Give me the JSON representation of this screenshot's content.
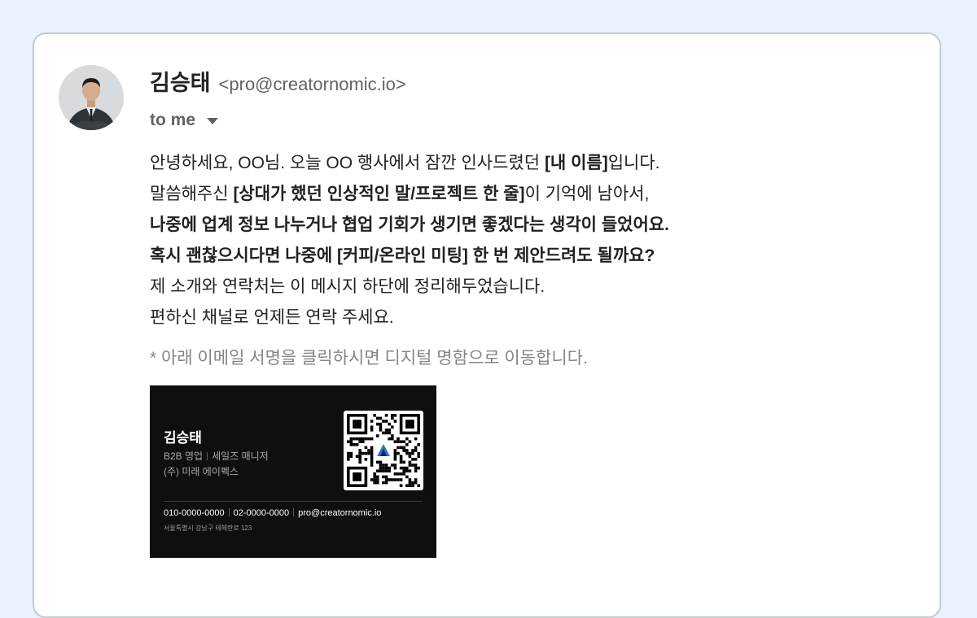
{
  "email": {
    "sender": {
      "name": "김승태",
      "email": "<pro@creatornomic.io>"
    },
    "recipient_label": "to me",
    "body": [
      [
        "안녕하세요, OO님. 오늘 OO 행사에서 잠깐 인사드렸던 ",
        "[내 이름]",
        "입니다."
      ],
      [
        "말씀해주신 ",
        "[상대가 했던 인상적인 말/프로젝트 한 줄]",
        "이 기억에 남아서,"
      ],
      [
        "",
        "나중에 업계 정보 나누거나 협업 기회가 생기면 좋겠다는 생각이 들었어요.",
        ""
      ],
      [
        "",
        "혹시 괜찮으시다면 나중에 [커피/온라인 미팅] 한 번 제안드려도 될까요?",
        ""
      ],
      [
        "제 소개와 연락처는 이 메시지 하단에 정리해두었습니다.",
        "",
        ""
      ],
      [
        "편하신 채널로 언제든 연락 주세요.",
        "",
        ""
      ]
    ],
    "note": "* 아래 이메일 서명을 클릭하시면 디지털 명함으로 이동합니다."
  },
  "signature": {
    "name": "김승태",
    "department": "B2B 영업",
    "role": "세일즈 매니저",
    "company": "(주) 미래 에이펙스",
    "mobile": "010-0000-0000",
    "phone": "02-0000-0000",
    "email": "pro@creatornomic.io",
    "address": "서울특별시 강남구 테헤란로 123",
    "qr_icon": "qr-code-icon",
    "logo_icon": "apex-triangle-logo"
  },
  "colors": {
    "page_background": "#e8f2fe",
    "card_border": "#c6c9ce",
    "signature_background": "#0f0f11",
    "logo_blue": "#2f6fe0"
  }
}
